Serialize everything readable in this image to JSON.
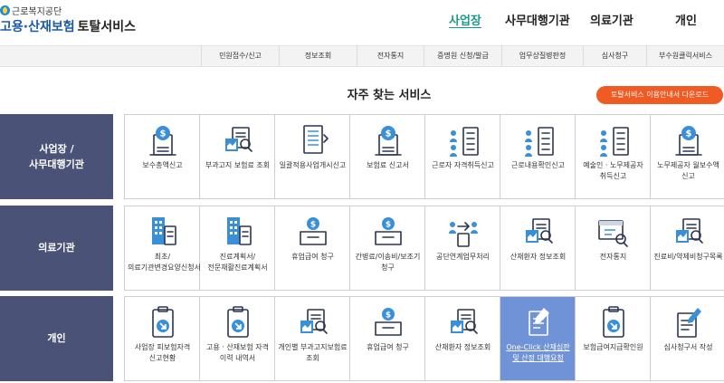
{
  "header": {
    "org_name": "근로복지공단",
    "logo_main": "고용·산재보험",
    "logo_sub": "토탈서비스",
    "nav": [
      "사업장",
      "사무대행기관",
      "의료기관",
      "개인"
    ]
  },
  "submenu": [
    "민원접수/신고",
    "정보조회",
    "전자통지",
    "증명원 신청/발급",
    "업무상질병판정",
    "심사청구",
    "부수원클릭서비스"
  ],
  "section_title": "자주 찾는 서비스",
  "guide_button": "토탈서비스 이용안내서 다운로드",
  "rows": [
    {
      "label_line1": "사업장 /",
      "label_line2": "사무대행기관",
      "items": [
        {
          "label": "보수총액신고",
          "icon": "money-bag-document-icon"
        },
        {
          "label": "부과고지 보험료 조회",
          "icon": "document-search-icon"
        },
        {
          "label": "일괄적용사업개시신고",
          "icon": "document-list-icon"
        },
        {
          "label": "보험료 신고서",
          "icon": "money-bag-document-icon"
        },
        {
          "label": "근로자 자격취득신고",
          "icon": "people-checklist-icon"
        },
        {
          "label": "근로내용확인신고",
          "icon": "people-checklist-icon"
        },
        {
          "label": "예술인 · 노무제공자 취득신고",
          "icon": "people-checklist-icon"
        },
        {
          "label": "노무제공자 월보수액 신고",
          "icon": "money-bag-document-icon"
        }
      ]
    },
    {
      "label_line1": "의료기관",
      "label_line2": "",
      "items": [
        {
          "label": "최초/의료기관변경요양신청서",
          "icon": "hospital-document-icon"
        },
        {
          "label": "진료계획서/전문재활진료계획서",
          "icon": "hospital-document-icon"
        },
        {
          "label": "휴업급여 청구",
          "icon": "money-box-icon"
        },
        {
          "label": "간병료/이송비/보조기 청구",
          "icon": "money-box-icon"
        },
        {
          "label": "공단연계업무처리",
          "icon": "linked-people-icon"
        },
        {
          "label": "산재환자 정보조회",
          "icon": "document-search-icon"
        },
        {
          "label": "전자통지",
          "icon": "box-search-icon"
        },
        {
          "label": "진료비/약제비청구목록",
          "icon": "document-search-icon"
        }
      ]
    },
    {
      "label_line1": "개인",
      "label_line2": "",
      "items": [
        {
          "label": "사업장 피보험자격 신고현황",
          "icon": "clipboard-arrow-icon"
        },
        {
          "label": "고용 · 산재보험 자격 이력 내역서",
          "icon": "clipboard-arrow-icon"
        },
        {
          "label": "개인별 부과고지보험료 조회",
          "icon": "document-search-icon"
        },
        {
          "label": "휴업급여 청구",
          "icon": "money-box-icon"
        },
        {
          "label": "산재환자 정보조회",
          "icon": "document-search-icon"
        },
        {
          "label": "One-Click 산재심판 및 산정 대행요청",
          "icon": "hand-pen-document-icon"
        },
        {
          "label": "보험급여지급확인원",
          "icon": "clipboard-arrow-icon"
        },
        {
          "label": "심사청구서 작성",
          "icon": "pen-document-icon"
        }
      ]
    }
  ],
  "colors": {
    "row_label_bg": "#4a5377",
    "highlight_bg": "#6f93d6",
    "guide_button_bg": "#f05a23",
    "active_nav": "#1a9a8a",
    "logo_blue": "#1a5aa6"
  }
}
